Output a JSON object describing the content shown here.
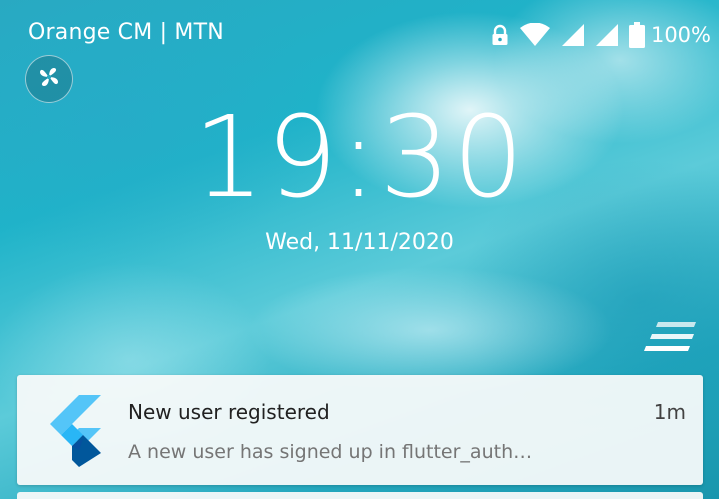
{
  "status_bar": {
    "carrier": "Orange CM | MTN",
    "battery_percent": "100%",
    "icons": [
      "lock-icon",
      "wifi-icon",
      "signal-icon",
      "signal-icon",
      "battery-icon"
    ]
  },
  "lock_screen": {
    "time": "19:30",
    "date": "Wed,  11/11/2020"
  },
  "notification": {
    "app_icon": "flutter-logo-icon",
    "title": "New user registered",
    "time": "1m",
    "body": "A new user has signed up in flutter_auth…"
  },
  "colors": {
    "text": "#ffffff",
    "notification_bg": "#f8fafa",
    "flutter_light": "#54c5f8",
    "flutter_dark": "#01579b"
  }
}
